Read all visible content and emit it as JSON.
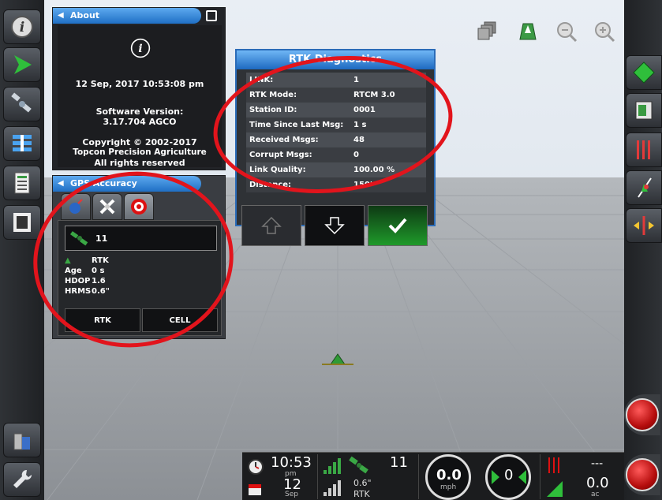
{
  "about": {
    "title": "About",
    "date": "12 Sep, 2017 10:53:08 pm",
    "version_label": "Software Version:",
    "version": "3.17.704 AGCO",
    "copyright": "Copyright © 2002-2017",
    "company": "Topcon Precision Agriculture",
    "rights": "All rights reserved"
  },
  "gps": {
    "title": "GPS Accuracy",
    "satellites": "11",
    "mode": "RTK",
    "rows": [
      {
        "label": "Age",
        "value": "0 s"
      },
      {
        "label": "HDOP",
        "value": "1.6"
      },
      {
        "label": "HRMS",
        "value": "0.6\""
      }
    ],
    "btn_rtk": "RTK",
    "btn_cell": "CELL"
  },
  "rtk": {
    "title": "RTK Diagnostics",
    "rows": [
      {
        "label": "LINK:",
        "value": "1"
      },
      {
        "label": "RTK Mode:",
        "value": "RTCM 3.0"
      },
      {
        "label": "Station ID:",
        "value": "0001"
      },
      {
        "label": "Time Since Last Msg:",
        "value": "1 s"
      },
      {
        "label": "Received Msgs:",
        "value": "48"
      },
      {
        "label": "Corrupt Msgs:",
        "value": "0"
      },
      {
        "label": "Link Quality:",
        "value": "100.00 %"
      },
      {
        "label": "Distance:",
        "value": "150'"
      }
    ]
  },
  "status": {
    "time": "10:53",
    "ampm": "pm",
    "day": "12",
    "month": "Sep",
    "sats": "11",
    "hrms": "0.6\"",
    "gps_mode": "RTK",
    "speed": "0.0",
    "speed_unit": "mph",
    "heading": "0",
    "area_top": "---",
    "area": "0.0",
    "area_unit": "ac"
  },
  "colors": {
    "accent": "#1f6fc4",
    "annotation": "#e2141c",
    "ok_green": "#1f9a2a"
  }
}
